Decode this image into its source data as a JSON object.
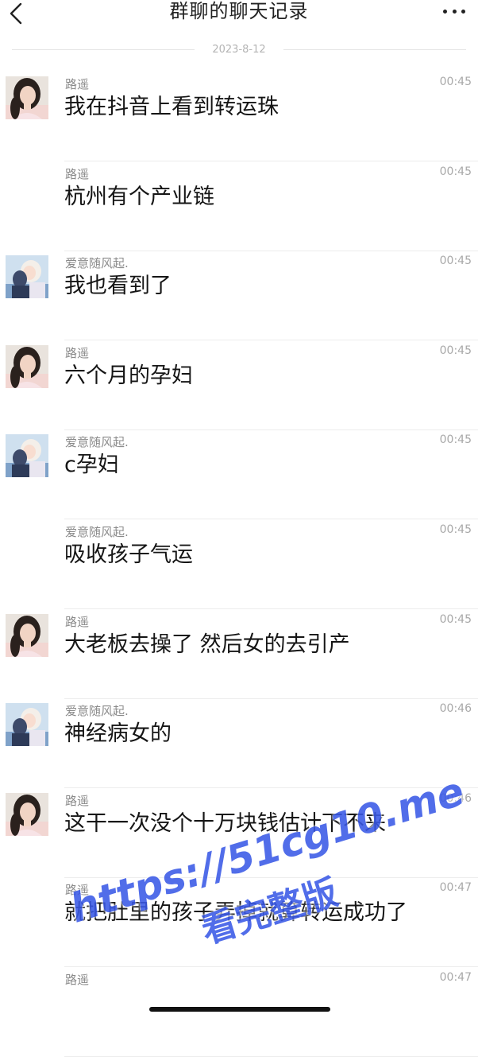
{
  "header": {
    "title": "群聊的聊天记录",
    "back_icon": "chevron-left-icon",
    "more_icon": "more-dots-icon"
  },
  "date_separator": "2023-8-12",
  "messages": [
    {
      "sender": "路遥",
      "time": "00:45",
      "text": "我在抖音上看到转运珠",
      "avatar": "girl"
    },
    {
      "sender": "路遥",
      "time": "00:45",
      "text": "杭州有个产业链",
      "avatar": ""
    },
    {
      "sender": "爱意随风起.",
      "time": "00:45",
      "text": "我也看到了",
      "avatar": "anime"
    },
    {
      "sender": "路遥",
      "time": "00:45",
      "text": "六个月的孕妇",
      "avatar": "girl"
    },
    {
      "sender": "爱意随风起.",
      "time": "00:45",
      "text": "c孕妇",
      "avatar": "anime"
    },
    {
      "sender": "爱意随风起.",
      "time": "00:45",
      "text": "吸收孩子气运",
      "avatar": ""
    },
    {
      "sender": "路遥",
      "time": "00:45",
      "text": "大老板去操了 然后女的去引产",
      "avatar": "girl"
    },
    {
      "sender": "爱意随风起.",
      "time": "00:46",
      "text": "神经病女的",
      "avatar": "anime"
    },
    {
      "sender": "路遥",
      "time": "00:46",
      "text": "这干一次没个十万块钱估计下不来",
      "avatar": "girl"
    },
    {
      "sender": "路遥",
      "time": "00:47",
      "text": "就把肚里的孩子弄掉就算转运成功了",
      "avatar": ""
    },
    {
      "sender": "路遥",
      "time": "00:47",
      "text": "",
      "avatar": ""
    }
  ],
  "watermark": {
    "line1": "https://51cg10.me",
    "line2": "看完整版",
    "color": "#3a59e6"
  }
}
